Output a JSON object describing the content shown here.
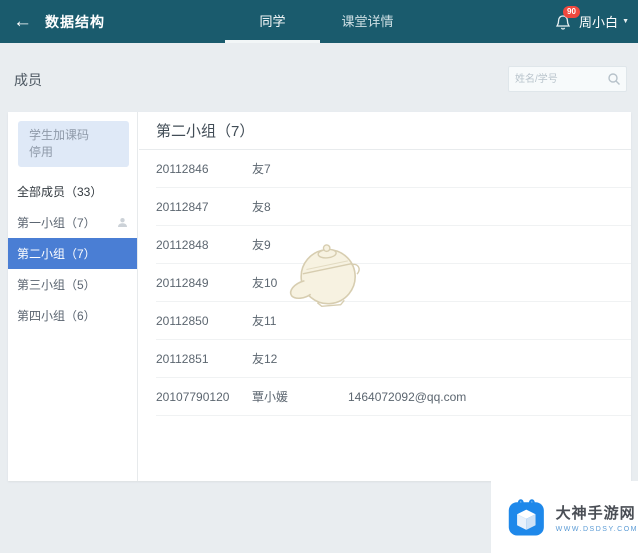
{
  "topbar": {
    "title": "数据结构",
    "tabs": [
      {
        "label": "同学",
        "active": true
      },
      {
        "label": "课堂详情",
        "active": false
      }
    ],
    "notification_count": "90",
    "user_name": "周小白"
  },
  "icons": {
    "back": "←",
    "caret_down": "▼",
    "bell": "bell-outline",
    "search": "magnifier",
    "group_member": "person-silhouette",
    "watermark": "teapot-sketch",
    "site_logo": "white-cube-in-blue-rounded-square"
  },
  "page": {
    "title": "成员"
  },
  "search": {
    "placeholder": "姓名/学号"
  },
  "sidebar": {
    "join_code_title": "学生加课码",
    "join_code_status": "停用",
    "items": [
      {
        "label": "全部成员（33）",
        "strong": true
      },
      {
        "label": "第一小组（7）",
        "icon": true
      },
      {
        "label": "第二小组（7）",
        "active": true
      },
      {
        "label": "第三小组（5）"
      },
      {
        "label": "第四小组（6）"
      }
    ]
  },
  "main": {
    "group_title": "第二小组（7）",
    "members": [
      {
        "id": "20112846",
        "name": "友7",
        "email": ""
      },
      {
        "id": "20112847",
        "name": "友8",
        "email": ""
      },
      {
        "id": "20112848",
        "name": "友9",
        "email": ""
      },
      {
        "id": "20112849",
        "name": "友10",
        "email": ""
      },
      {
        "id": "20112850",
        "name": "友11",
        "email": ""
      },
      {
        "id": "20112851",
        "name": "友12",
        "email": ""
      },
      {
        "id": "20107790120",
        "name": "覃小媛",
        "email": "1464072092@qq.com"
      }
    ]
  },
  "footer": {
    "site_name": "大神手游网",
    "site_url": "WWW.DSDSY.COM"
  },
  "colors": {
    "topbar-bg": "#1a5b6d",
    "page-bg": "#e9edf0",
    "active-group-bg": "#4a7ed4",
    "badge-red": "#f0483e",
    "join-box-bg": "#dfe9f7",
    "logo-blue": "#1e88ea",
    "url-blue": "#5b9bd5"
  }
}
